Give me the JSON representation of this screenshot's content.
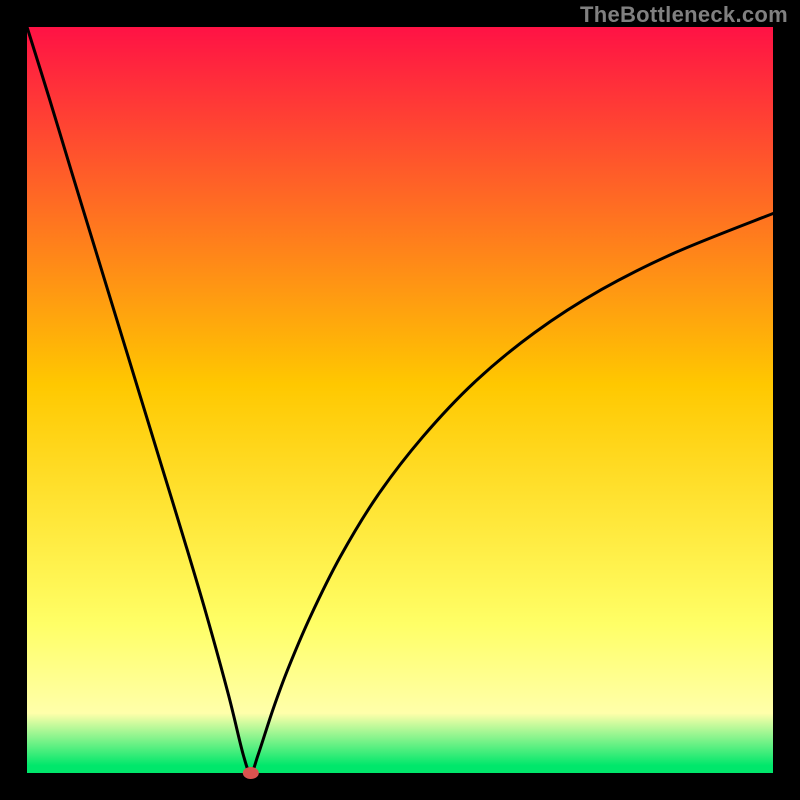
{
  "attribution": "TheBottleneck.com",
  "chart_data": {
    "type": "line",
    "title": "",
    "xlabel": "",
    "ylabel": "",
    "x_range": [
      0,
      1000
    ],
    "y_range": [
      0,
      100
    ],
    "series": [
      {
        "name": "curve",
        "x": [
          0,
          30,
          60,
          90,
          120,
          150,
          180,
          210,
          240,
          270,
          290,
          300,
          310,
          330,
          350,
          380,
          420,
          470,
          530,
          600,
          680,
          770,
          870,
          1000
        ],
        "y": [
          100,
          90.4,
          80.5,
          70.7,
          60.9,
          51.1,
          41.3,
          31.5,
          21.4,
          10.5,
          2.4,
          0.0,
          2.5,
          8.6,
          14.0,
          21.0,
          29.0,
          37.2,
          45.0,
          52.4,
          59.0,
          64.8,
          69.8,
          75.0
        ]
      }
    ],
    "marker": {
      "x": 300,
      "y": 0
    },
    "colors": {
      "gradient_top": "#ff1245",
      "gradient_mid": "#ffc800",
      "gradient_low": "#ffff66",
      "gradient_base": "#00e76b",
      "frame": "#000000",
      "curve": "#000000",
      "marker": "#d9534f"
    },
    "frame_thickness": 27
  }
}
